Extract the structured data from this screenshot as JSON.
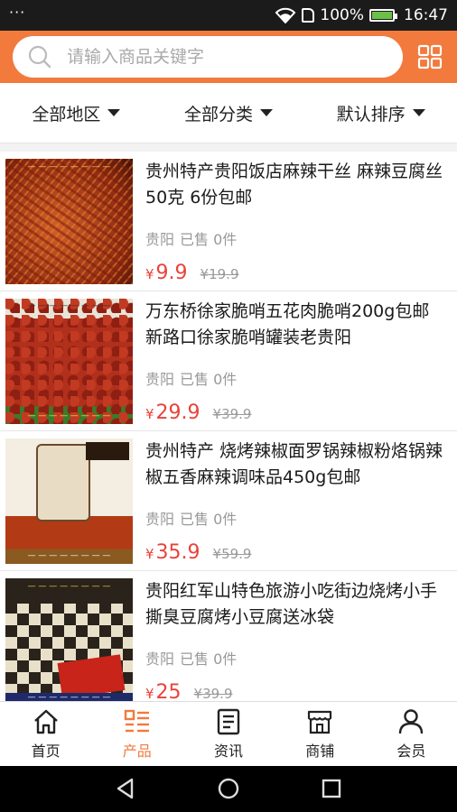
{
  "status_bar": {
    "menu_dots": "···",
    "battery_text": "100%",
    "time": "16:47",
    "battery_level": 1.0
  },
  "search": {
    "placeholder": "请输入商品关键字"
  },
  "filters": [
    {
      "label": "全部地区"
    },
    {
      "label": "全部分类"
    },
    {
      "label": "默认排序"
    }
  ],
  "products": [
    {
      "title": "贵州特产贵阳饭店麻辣干丝 麻辣豆腐丝50克 6份包邮",
      "location": "贵阳",
      "sold": "已售 0件",
      "currency": "¥",
      "price": "9.9",
      "original_price": "¥19.9"
    },
    {
      "title": "万东桥徐家脆哨五花肉脆哨200g包邮新路口徐家脆哨罐装老贵阳",
      "location": "贵阳",
      "sold": "已售 0件",
      "currency": "¥",
      "price": "29.9",
      "original_price": "¥39.9"
    },
    {
      "title": "贵州特产 烧烤辣椒面罗锅辣椒粉烙锅辣椒五香麻辣调味品450g包邮",
      "location": "贵阳",
      "sold": "已售 0件",
      "currency": "¥",
      "price": "35.9",
      "original_price": "¥59.9"
    },
    {
      "title": "贵阳红军山特色旅游小吃街边烧烤小手撕臭豆腐烤小豆腐送冰袋",
      "location": "贵阳",
      "sold": "已售 0件",
      "currency": "¥",
      "price": "25",
      "original_price": "¥39.9"
    }
  ],
  "tabs": [
    {
      "label": "首页",
      "icon": "home-icon"
    },
    {
      "label": "产品",
      "icon": "product-list-icon"
    },
    {
      "label": "资讯",
      "icon": "news-icon"
    },
    {
      "label": "商铺",
      "icon": "shop-icon"
    },
    {
      "label": "会员",
      "icon": "user-icon"
    }
  ],
  "colors": {
    "accent": "#f27a3d",
    "price": "#e8433a",
    "status_bar": "#1b1b1b"
  }
}
